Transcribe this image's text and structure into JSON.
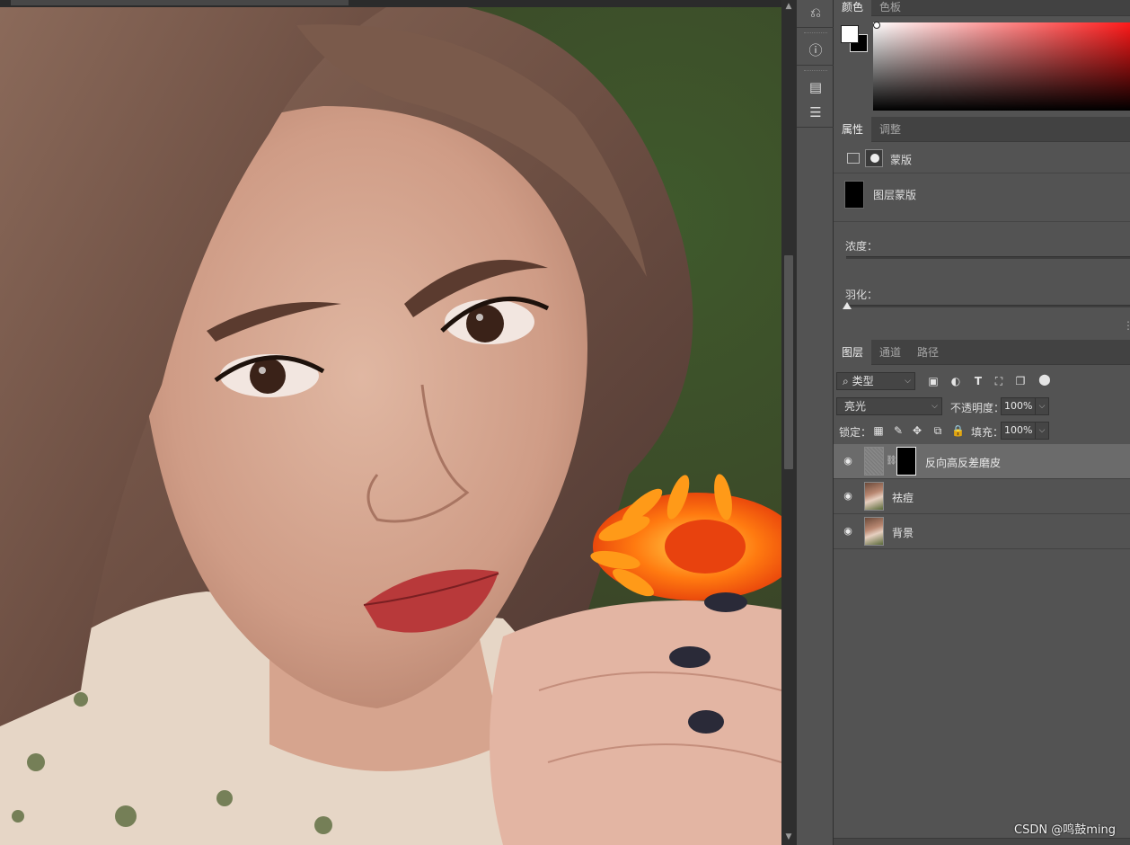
{
  "tool_strip": {
    "icons": [
      "history-icon",
      "info-icon",
      "properties-panel-icon",
      "notes-icon"
    ]
  },
  "color_panel": {
    "tabs": [
      {
        "label": "颜色",
        "active": true
      },
      {
        "label": "色板",
        "active": false
      }
    ],
    "foreground": "#ffffff",
    "background": "#000000",
    "hue": "#ff1a1a"
  },
  "properties_panel": {
    "tabs": [
      {
        "label": "属性",
        "active": true
      },
      {
        "label": "调整",
        "active": false
      }
    ],
    "section_label": "蒙版",
    "mask_label": "图层蒙版",
    "density_label": "浓度：",
    "feather_label": "羽化："
  },
  "layers_panel": {
    "tabs": [
      {
        "label": "图层",
        "active": true
      },
      {
        "label": "通道",
        "active": false
      },
      {
        "label": "路径",
        "active": false
      }
    ],
    "filter_type": "类型",
    "blend_mode": "亮光",
    "opacity_label": "不透明度：",
    "opacity_value": "100%",
    "lock_label": "锁定：",
    "fill_label": "填充：",
    "fill_value": "100%",
    "layers": [
      {
        "name": "反向高反差磨皮",
        "selected": true,
        "has_mask": true
      },
      {
        "name": "祛痘",
        "selected": false,
        "has_mask": false
      },
      {
        "name": "背景",
        "selected": false,
        "has_mask": false
      }
    ]
  },
  "watermark": "CSDN @鸣鼓ming"
}
